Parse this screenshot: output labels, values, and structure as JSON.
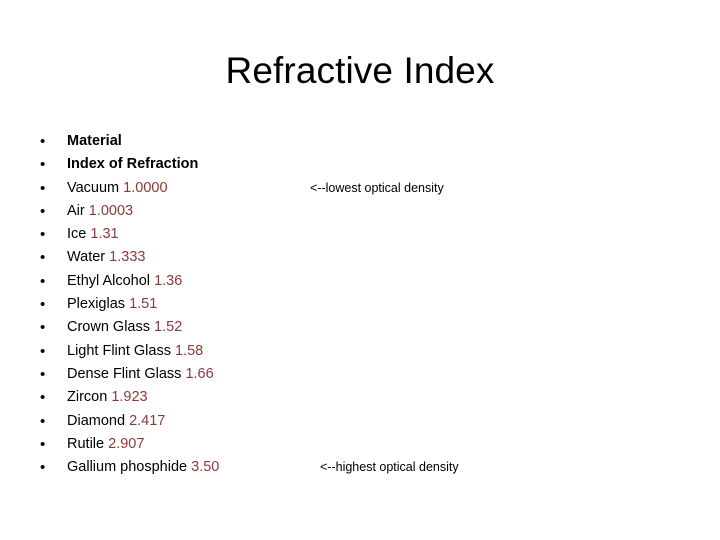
{
  "slide": {
    "title": "Refractive Index",
    "bullet_glyph": "•",
    "accent_color": "#8B3A3A",
    "text_color": "#000000",
    "background_color": "#FFFFFF"
  },
  "rows": [
    {
      "name": "Material",
      "value": "",
      "bold": true,
      "annotation": ""
    },
    {
      "name": "Index of Refraction",
      "value": "",
      "bold": true,
      "annotation": ""
    },
    {
      "name": "Vacuum",
      "value": "1.0000",
      "bold": false,
      "annotation": "<--lowest optical density"
    },
    {
      "name": "Air",
      "value": "1.0003",
      "bold": false,
      "annotation": ""
    },
    {
      "name": "Ice",
      "value": "1.31",
      "bold": false,
      "annotation": ""
    },
    {
      "name": "Water",
      "value": "1.333",
      "bold": false,
      "annotation": ""
    },
    {
      "name": "Ethyl Alcohol",
      "value": "1.36",
      "bold": false,
      "annotation": ""
    },
    {
      "name": "Plexiglas",
      "value": "1.51",
      "bold": false,
      "annotation": ""
    },
    {
      "name": "Crown Glass",
      "value": "1.52",
      "bold": false,
      "annotation": ""
    },
    {
      "name": "Light Flint Glass",
      "value": "1.58",
      "bold": false,
      "annotation": ""
    },
    {
      "name": "Dense Flint Glass",
      "value": "1.66",
      "bold": false,
      "annotation": ""
    },
    {
      "name": "Zircon",
      "value": "1.923",
      "bold": false,
      "annotation": ""
    },
    {
      "name": "Diamond",
      "value": "2.417",
      "bold": false,
      "annotation": ""
    },
    {
      "name": "Rutile",
      "value": "2.907",
      "bold": false,
      "annotation": ""
    },
    {
      "name": "Gallium phosphide",
      "value": "3.50",
      "bold": false,
      "annotation": "<--highest optical density"
    }
  ]
}
